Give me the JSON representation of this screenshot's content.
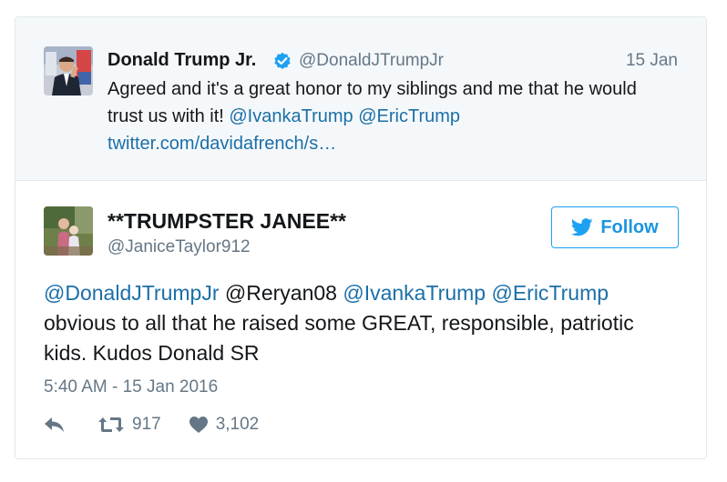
{
  "quoted_tweet": {
    "author_name": "Donald Trump Jr.",
    "author_handle": "@DonaldJTrumpJr",
    "date": "15 Jan",
    "text_line1": "Agreed and it's a great honor to my siblings and me that he would",
    "text_line2_prefix": "trust us with it!",
    "mention1": "@IvankaTrump",
    "mention2": "@EricTrump",
    "link": "twitter.com/davidafrench/s…"
  },
  "tweet": {
    "author_name": "**TRUMPSTER JANEE**",
    "author_handle": "@JaniceTaylor912",
    "follow_label": "Follow",
    "mentions": [
      "@DonaldJTrumpJr",
      "@Reryan08",
      "@IvankaTrump",
      "@EricTrump"
    ],
    "text_line2": "obvious to all that he raised some GREAT, responsible, patriotic",
    "text_line3": "kids. Kudos Donald SR",
    "timestamp": "5:40 AM - 15 Jan 2016",
    "retweet_count": "917",
    "like_count": "3,102"
  },
  "colors": {
    "link": "#1b6fa8",
    "twitter_blue": "#1da1f2",
    "muted": "#657786",
    "quoted_bg": "#f5f8fa",
    "border": "#e1e8ed"
  },
  "icons": [
    "verified-badge-icon",
    "twitter-bird-icon",
    "reply-icon",
    "retweet-icon",
    "heart-icon"
  ]
}
